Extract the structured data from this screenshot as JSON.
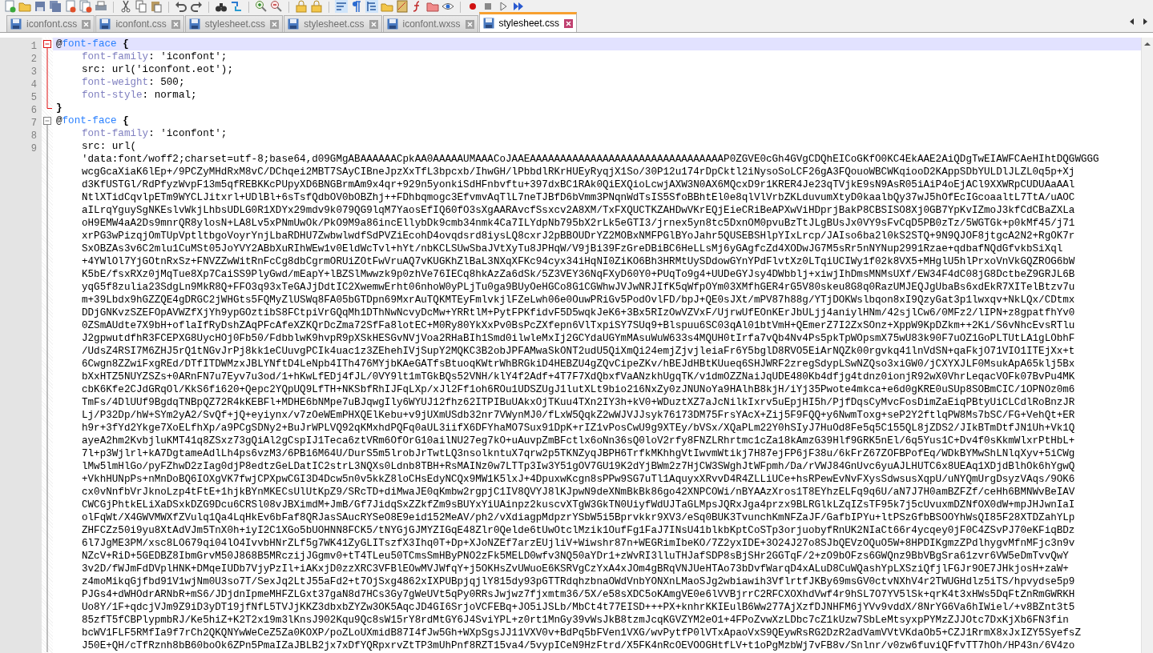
{
  "tabs": [
    {
      "label": "iconfont.css",
      "selected": false
    },
    {
      "label": "iconfont.css",
      "selected": false
    },
    {
      "label": "stylesheet.css",
      "selected": false
    },
    {
      "label": "stylesheet.css",
      "selected": false
    },
    {
      "label": "iconfont.wxss",
      "selected": false
    },
    {
      "label": "stylesheet.css",
      "selected": true
    }
  ],
  "editor": {
    "rows": [
      {
        "number": "1",
        "kind": "open",
        "active_fold": true,
        "current": true,
        "tokens": [
          {
            "kind": "at",
            "text": "@"
          },
          {
            "kind": "keyword",
            "text": "font-face"
          },
          {
            "kind": "brace",
            "text": " {"
          }
        ]
      },
      {
        "number": "2",
        "kind": "declaration",
        "active_fold": true,
        "current": false,
        "tokens": [
          {
            "kind": "property",
            "text": "font-family"
          },
          {
            "kind": "value",
            "text": ": 'iconfont';"
          }
        ]
      },
      {
        "number": "3",
        "kind": "declaration",
        "active_fold": true,
        "current": false,
        "tokens": [
          {
            "kind": "value",
            "text": "src: url('iconfont.eot');"
          }
        ]
      },
      {
        "number": "4",
        "kind": "declaration",
        "active_fold": true,
        "current": false,
        "tokens": [
          {
            "kind": "property",
            "text": "font-weight"
          },
          {
            "kind": "value",
            "text": ": 500;"
          }
        ]
      },
      {
        "number": "5",
        "kind": "declaration",
        "active_fold": true,
        "current": false,
        "tokens": [
          {
            "kind": "property",
            "text": "font-style"
          },
          {
            "kind": "value",
            "text": ": normal;"
          }
        ]
      },
      {
        "number": "6",
        "kind": "close",
        "active_fold": true,
        "current": false,
        "tokens": [
          {
            "kind": "brace",
            "text": "}"
          }
        ]
      },
      {
        "number": "7",
        "kind": "open",
        "active_fold": false,
        "current": false,
        "tokens": [
          {
            "kind": "at",
            "text": "@"
          },
          {
            "kind": "keyword",
            "text": "font-face"
          },
          {
            "kind": "brace",
            "text": " {"
          }
        ]
      },
      {
        "number": "8",
        "kind": "declaration",
        "active_fold": false,
        "current": false,
        "tokens": [
          {
            "kind": "property",
            "text": "font-family"
          },
          {
            "kind": "value",
            "text": ": 'iconfont';"
          }
        ]
      },
      {
        "number": "9",
        "kind": "declaration",
        "active_fold": false,
        "current": false,
        "tokens": [
          {
            "kind": "value",
            "text": "src: url("
          }
        ]
      },
      {
        "kind": "wrap",
        "active_fold": false,
        "current": false,
        "text": "'data:font/woff2;charset=utf-8;base64,d09GMgABAAAAAACpkAA0AAAAAUMAAACoJAAEAAAAAAAAAAAAAAAAAAAAAAAAAAAAAAAAP0ZGVE0cGh4GVgCDQhEICoGKfO0KC4EkAAE2AiQDgTwEIAWFCAeHIhtDQGWGGG"
      },
      {
        "kind": "wrap",
        "active_fold": false,
        "current": false,
        "text": "wcgGcaXiaK6lEp+/9PCZyMHdRxM8vC/DChqei2MBT7SAyCIBneJpzXxTfL3bpcxb/IhwGH/lPbbdlRKrHUEyRyqjX1So/30P12u174rDpCktl2iNysoSoLCF26gA3FQouoWBCWKqiooD2KAppSDbYULDlJLZL0q5p+Xj"
      },
      {
        "kind": "wrap",
        "active_fold": false,
        "current": false,
        "text": "d3KfUSTGl/RdPfyzWvpF13m5qfREBKKcPUpyXD6BNGBrmAm9x4qr+929n5yonkiSdHFnbvftu+397dxBC1RAk0QiEXQioLcwjAXW3N0AX6MQcxD9r1KRER4Je23qTVjkE9sN9AsR05iAiP4oEjACl9XXWRpCUDUAaAAl"
      },
      {
        "kind": "wrap",
        "active_fold": false,
        "current": false,
        "text": "NtlXTidCqvlpETm9WYCLJitxrl+UDlBl+6sTsfQdbOV0bOBZhj++FDhbqmogc3EfvmvAqTlL7neTJBfD6bVmm3PNqnWdTsIS5SfoBBhtEl0e8qlVlVrbZKLduvumXtyD0kaalbQy37wJ5hOfEcIGcoaaltL7TtA/uAOC"
      },
      {
        "kind": "wrap",
        "active_fold": false,
        "current": false,
        "text": "aILrqYguySgNKEslvWkjLhbsUDLG0R1XDYx29mdv9k079QG9lqM7YaosEfIQ60fO3sXgAARAvcfSsxcv2A8XM/TxFXQUCTKZAHDwVKrEQjEieCRiBeAPXwViHDprjBakP8CBSISO8Xj0GB7YpKvIZmoJ3kfCdCBaZXLa"
      },
      {
        "kind": "wrap",
        "active_fold": false,
        "current": false,
        "text": "oH9EMW4aA2Ds9mnrQR8ylosN+LA8Lv5xPNmUwOk/PkO9M9a86incEllybDk9cmb34nmk4Ca7ILYdpNb795bX2rLk5eGTI3/jrnex5yn8tc5DxnOM0pvuBzTtJLgBUsJx0VY9sFvCqD5PB0zTz/5WGTGk+p0kMf45/j71"
      },
      {
        "kind": "wrap",
        "active_fold": false,
        "current": false,
        "text": "xrPG3wPizqjOmTUpVptltbgoVoyrYnjLbaRDHU7ZwbwlwdfSdPVZiEcohD4ovqdsrd8iysLQ8cxrJ2pBBOUDrYZ2MOBxNMFPGlBYoJahr5QUSEBSHlpYIxLrcp/JAIso6ba2l0kS2STQ+9N9QJOF8jtgcA2N2+RgOK7r"
      },
      {
        "kind": "wrap",
        "active_fold": false,
        "current": false,
        "text": "SxOBZAs3v6C2mlu1CuMSt05JoYVY2ABbXuRIhWEw1v0EldWcTvl+hYt/nbKCLSUwSbaJVtXyTu8JPHqW/V9jBi39FzGreDBiBC6HeLLsMj6yGAgfcZd4XODwJG7M5sRr5nNYNup2991Rzae+qdbafNQdGfvkbSiXql"
      },
      {
        "kind": "wrap",
        "active_fold": false,
        "current": false,
        "text": "+4YWlOl7YjGOtnRxSz+FNVZZwWitRnFcCg8dbCgrmORUiZOtFwVruAQ7vKUGKhZlBaL3NXqXFKc94cyx34iHqNI0ZiKO6Bh3HRMtUySDdowGYnYPdFlvtXz0LTqiUCIWy1f02k8VX5+MHglU5hlPrxoVnVkGQZROG6bW"
      },
      {
        "kind": "wrap",
        "active_fold": false,
        "current": false,
        "text": "K5bE/fsxRXz0jMqTue8Xp7CaiSS9PlyGwd/mEapY+lBZSlMwwzk9p0zhVe76IECq8hkAzZa6dSk/5Z3VEY36NqFXyD60Y0+PUqTo9g4+UUDeGYJsy4DWbblj+xiwjIhDmsMNMsUXf/EW34F4dC08jG8DctbeZ9GRJL6B"
      },
      {
        "kind": "wrap",
        "active_fold": false,
        "current": false,
        "text": "yqG5f8zulia23SdgLn9MkR8Q+FFO3q93xTeGAJjDdtIC2XwemwErht06nhoW0yPLjTu0ga9BUyOeHGCo8G1CGWhwJVJwNRJIfK5qWfpOYm03XMfhGER4rG5V80skeu8G8q0RazUMJEQJgUbaBs6xdEkR7XITelBtzv7u"
      },
      {
        "kind": "wrap",
        "active_fold": false,
        "current": false,
        "text": "m+39Lbdx9hGZZQE4gDRGC2jWHGts5FQMyZlUSWq8FA05bGTDpn69MxrAuTQKMTEyFmlvkjlFZeLwh06e0OuwPRiGv5PodOvlFD/bpJ+QE0sJXt/mPV87h88g/YTjDOKWslbqon8xI9QzyGat3p1lwxqv+NkLQx/CDtmx"
      },
      {
        "kind": "wrap",
        "active_fold": false,
        "current": false,
        "text": "DDjGNKvzSZEFOpAVWZfXjYh9ypGOztibS8FCtpiVrGQqMh1DThNwNcvyDcMw+YRRtlM+PytFPKfidvF5D5wqkJeK6+3Bx5RIzOwVZVxF/UjrwUfEOnKErJbULjj4aniylHNm/42sjlCw6/0MFz2/lIPN+z8gpatfhYv0"
      },
      {
        "kind": "wrap",
        "active_fold": false,
        "current": false,
        "text": "0ZSmAUdte7X9bH+oflaIfRyDshZAqPFcAfeXZKQrDcZma72SfFa8lotEC+M0Ry80YkXxPv0BsPcZXfepn6VlTxpiSY7SUq9+Blspuu6SC03qAl01btVmH+QEmerZ7I2ZxSOnz+XppW9KpDZkm++2Ki/S6vNhcEvsRTlu"
      },
      {
        "kind": "wrap",
        "active_fold": false,
        "current": false,
        "text": "J2gpwutdfhR3FCEPXG8UycHOj0Fb50/FdbblwK9hvpR9pXSkHESGvNVjVoa2RHaBIh1Smd0ilwleMxIj2GCYdaUGYmMAsuWuW633s4MQUH0tIrfa7vQb4Nv4Ps5pkTpWOpsmX75wU83k90F7uOZ1GoPLTUtLA1gLObhF"
      },
      {
        "kind": "wrap",
        "active_fold": false,
        "current": false,
        "text": "/UdsZ4RSI7M6ZHJ5rQ1tNGvJrPj8kk1eCUuvgPCIk4uac1z3ZEhehIVjSupY2MQKC3B2obJPFAMwaSkONT2udU5QiXmQi24emjZjvjleiaFr6Y5bglD8RVO5EiArNQZk00rgvkq41lnVdSN+qaFkjO71VIO1ITEjXx+t"
      },
      {
        "kind": "wrap",
        "active_fold": false,
        "current": false,
        "text": "6Cwgn8ZZwiFxgREd/DTfITDWMzxJBLYNftD4LeNpb4ITh476MYjbKAeGATfsBtuoqKWtrWhBRGkiD4HEBZU4gZQvCipeZKv/hBEJdHBtKUueq6SHJWRF2zregSdypLSwNZQso3xiGW0/jCXYXJLF0MsukApA65klj5Bx"
      },
      {
        "kind": "wrap",
        "active_fold": false,
        "current": false,
        "text": "bXxHTZ5NUYZSZs+0ARnFN7u7Eyv7u3od/1+hKwLfEDj4fJL/0VY9lt1mTGkBQs52VNH/klY4f2Adf+4T7F7XdQbxfVaANzkhUgqTK/v1dmOZZNaiJqUDE480Kb4dfjg4tdnz0ionjR92wX0VhrLeqacVOFk07BvPu4MK"
      },
      {
        "kind": "wrap",
        "active_fold": false,
        "current": false,
        "text": "cbK6Kfe2CJdGRqOl/KkS6fi620+Qepc2YQpUQ9LfTH+NKSbfRhIJFqLXp/xJl2Ff1oh6ROu1UDSZUgJ1lutXLt9bio216NxZy0zJNUNoYa9HAlhB8kjH/iYj35Pwote4mkca+e6d0gKRE0uSUp8SOBmCIC/1OPNOz0m6"
      },
      {
        "kind": "wrap",
        "active_fold": false,
        "current": false,
        "text": "TmFs/4DlUUf9BgdqTNBpQZ72R4kKEBFl+MDHE6bNMpe7uBJqwgIly6WYUJ12fhz62ITPIBuUAkxOjTKuu4TXn2IY3h+kV0+WDuztXZ7aJcNilkIxrv5uEpjHI5h/PjfDqsCyMvcFosDimZaEiqPBtyUiCLCdlRoBnzJR"
      },
      {
        "kind": "wrap",
        "active_fold": false,
        "current": false,
        "text": "Lj/P32Dp/hW+SYm2yA2/SvQf+jQ+eyiynx/v7zOeWEmPHXQElKebu+v9jUXmUSdb32nr7VWynMJ0/fLxW5QqkZ2wWJVJJsyk76173DM75FrsYAcX+Zij5F9FQQ+y6NwmToxg+seP2Y2ftlqPW8Ms7bSC/FG+VehQt+ER"
      },
      {
        "kind": "wrap",
        "active_fold": false,
        "current": false,
        "text": "h9r+3fYd2Ykge7XoELfhXp/a9PCgSDNy2+BuJrWPLVQ92qKMxhdPQFq0aUL3iifX6DFYhaMO7Sux91DpK+rIZ1vPosCwU9g9XTEy/bVSx/XQaPLm22Y0hSIyJ7HuOd8Fe5q5C155QL8jZDS2/JIkBTmDtfJN1Uh+Vk1Q"
      },
      {
        "kind": "wrap",
        "active_fold": false,
        "current": false,
        "text": "ayeA2hm2KvbjluKMT41q8ZSxz73gQiAl2gCspIJ1Teca6ztVRm6OfOrG10ailNU27eg7kO+uAuvpZmBFctlx6oNn36sQ0loV2rfy8FNZLRhrtmc1cZa18kAmzG39Hlf9GRK5nEl/6q5Yus1C+Dv4f0sKkmWlxrPtHbL+"
      },
      {
        "kind": "wrap",
        "active_fold": false,
        "current": false,
        "text": "7l+p3Wjlrl+kA7DgtameAdlLh4ps6vzM3/6PB16M64U/DurS5m5lrobJrTwtLQ3nsolkntuX7qrw2p5TKNZyqJBPH6TrfkMKhhgVtIwvmWtikj7H87ejFP6jF38u/6kFrZ67ZOFBPofEq/WDkBYMwShLNlqXyv+5iCWg"
      },
      {
        "kind": "wrap",
        "active_fold": false,
        "current": false,
        "text": "lMw5lmHlGo/pyFZhwD2zIag0djP8edtzGeLDatIC2strL3NQXs0Ldnb8TBH+RsMAINz0w7LTTp3Iw3Y51gOV7GU19K2dYjBWm2z7HjCW3SWghJtWFpmh/Da/rVWJ84GnUvc6yuAJLHUTC6x8UEAq1XDjdBlhOk6hYgwQ"
      },
      {
        "kind": "wrap",
        "active_fold": false,
        "current": false,
        "text": "+VkhHUNpPs+nMnDoBQ6IOXgVK7fwjCPXpwCGI3D4Dcw5n0v5kkZ8loCHsEdyNCQx9MW1K5lxJ+4DpuxwKcgn8sPPw9SG7uTl1AquyxXRvvD4R4ZLLiUCe+hsRPewEvNvFXysSdwsusXqpU/uNYQmUrgDsyzVAqs/9OK6"
      },
      {
        "kind": "wrap",
        "active_fold": false,
        "current": false,
        "text": "cx0vNnfbVrJknoLzp4tFtE+1hjkBYnMKECsUlUtKpZ9/SRcTD+diMwaJE0qKmbw2rgpjC1IV8QVYJ8lKJpwN9deXNmBkBk86go42XNPCOWi/nBYAAzXros1T8EYhzELFq9q6U/aN7J7H0amBZFZf/ceHh6BMNWvBeIAV"
      },
      {
        "kind": "wrap",
        "active_fold": false,
        "current": false,
        "text": "CWCGjPhtkELiXaDSxkDZG9Dcu6CRSl08vJBXimdM+JmB/Gf7JidqSxZZkfZm9sBUYxYiUAinpz2kuscvXTgW3GkTN0UiyfWdUJTaGLMpsJQRxJga4przx9BLRGlkLZqIZsTF95k7j5cUvuxmDZNfOX0dW+mpJHJwnIaI"
      },
      {
        "kind": "wrap",
        "active_fold": false,
        "current": false,
        "text": "olFqWt/X4GWVMWXfZVulq1Qa4LqHkEv6bFaf8QRJasSAucRYSeO8E9eid152MeAV/ph2/vXdiagpMdpzrYSbW5i5Bprvkkr9XV3/eSq0BUK3TvunchKmNFZaJF/GafbIPYu+ltPSzGfbBSOOYhWsQI85F28XTDZahYLp"
      },
      {
        "kind": "wrap",
        "active_fold": false,
        "current": false,
        "text": "ZHFCZz50i9yu8XtAdVJm5TnX0h+iyI2C1XGo5bUOHNN8FCK5/tNYGjGJMYZIGqE48Zlr0Qelde6tUwOtclMzik1OufFg1FaJ7INsU41blkbKptCoSTp3orjuobyfRnUK2NIaCt66r4ycqey0jF0C4ZSvPJ70eKFiqBDz"
      },
      {
        "kind": "wrap",
        "active_fold": false,
        "current": false,
        "text": "6l7JgME3PM/xsc8LO679qi04lO4IvvbHNrZLf5g7WK41ZyGLITszfX3Ihq0T+Dp+XJoNZEf7arzEUjliV+Wiwshr87n+WEGRimIbeKO/7Z2yxIDE+3O24J27o8SJbQEVzOQuO5W+8HPDIKgmzZPdlhygvMfnMFjc3n9v"
      },
      {
        "kind": "wrap",
        "active_fold": false,
        "current": false,
        "text": "NZcV+RiD+5GEDBZ8IbmGrvM50J868B5MRczijJGgmv0+tT4TLeu50TCmsSmHByPNO2zFk5MELD0wfv3NQ50aYDr1+zWvRI3lluTHJafSDP8sBjSHr2GGTqF/2+zO9bOFzs6GWQnz9BbVBgSra61zvr6VW5eDmTvvQwY"
      },
      {
        "kind": "wrap",
        "active_fold": false,
        "current": false,
        "text": "3v2D/fWJmFdDVplHNK+DMqeIUDb7VjyPzIl+iAKxjD0zzXRC3VFBlEOwMVJWfqY+j5OKHsZvUWuoE6KSRVgCzYxA4xJOm4gBRqVNJUeHTAo73bDvfWarqD4xALuD8CuWQashYpLXSziQfjlFGJr9OE7JHkjosH+zaW+"
      },
      {
        "kind": "wrap",
        "active_fold": false,
        "current": false,
        "text": "z4moMikqGjfbd91V1wjNm0U3so7T/SexJq2LtJ55aFd2+t7OjSxg4862xIXPUBpjqjlY815dy93pGTTRdqhzbnaOWdVnbYONXnLMaoSJg2wbiawih3VflrtfJKBy69msGV0ctvNXhV4r2TWUGHdlz5iTS/hpvydse5p9"
      },
      {
        "kind": "wrap",
        "active_fold": false,
        "current": false,
        "text": "PJGs4+dWHOdrARNbR+mS6/JDjdnIpmeMHFZLGxt37gaN8d7HCs3Gy7gWeUVt5qPy0RRsJwjwz7fjxmtm36/5X/e58sXDC5oKAmgVE0e6lVVBjrrC2RFCXOXhdVwf4r9hSL7O7YV5lSk+qrK4t3xHWs5DqFtZnRmGWRKH"
      },
      {
        "kind": "wrap",
        "active_fold": false,
        "current": false,
        "text": "Uo8Y/1F+qdcjVJm9Z9iD3yDT19jfNfL5TVJjKKZ3dbxbZYZw3OK5AqcJD4GI6SrjoVCFEBq+JO5iJSLb/MbCt4t77EISD+++PX+knhrKKIEulB6Ww277AjXzfDJNHFM6jYVv9vddX/8NrYG6Va6hIWiel/+v8BZnt3t5"
      },
      {
        "kind": "wrap",
        "active_fold": false,
        "current": false,
        "text": "85zfT5fCBPlypmbRJ/Ke5hiZ+K2T2x19m3lKnsJ902Kqu9Qc8sW15rY8rdMtGY6J4SviYPL+z0rt1MnGy39vWsJkB8tzmJcqKGVZYM2eO1+4FPoZvwXzLDbc7cZ1kUzw7SbLeMtsyxpPYMzZJJOtc7DxKjXb6FN3fin"
      },
      {
        "kind": "wrap",
        "active_fold": false,
        "current": false,
        "text": "bcWV1FLF5RMfIa9f7rCh2QKQNYwWeCeZ5Za0KOXP/poZLoUXmidB87I4fJw5Gh+WXpSgsJJ11VXV0v+BdPq5bFVen1VXG/wvPytfP0lVTxApaoVxS9QEywRsRG2DzR2adVamVVtVKdaOb5+CZJ1RrmX8xJxIZY5SyefsZ"
      },
      {
        "kind": "wrap",
        "active_fold": false,
        "current": false,
        "text": "J50E+QH/cTfRznh8bB60boOk6ZPn5PmaIZaJBLB2jx7xDfYQRpxrvZtTP3mUhPnf8RZT15va4/5vypICeN9HzFtrd/X5FK4nRcOEVOOGHtfLV+t1oPgMzbWj7vFB8v/Snlnr/v0zw6fuviQFfvTT7hOh/HP43n/6V4zo"
      }
    ]
  }
}
